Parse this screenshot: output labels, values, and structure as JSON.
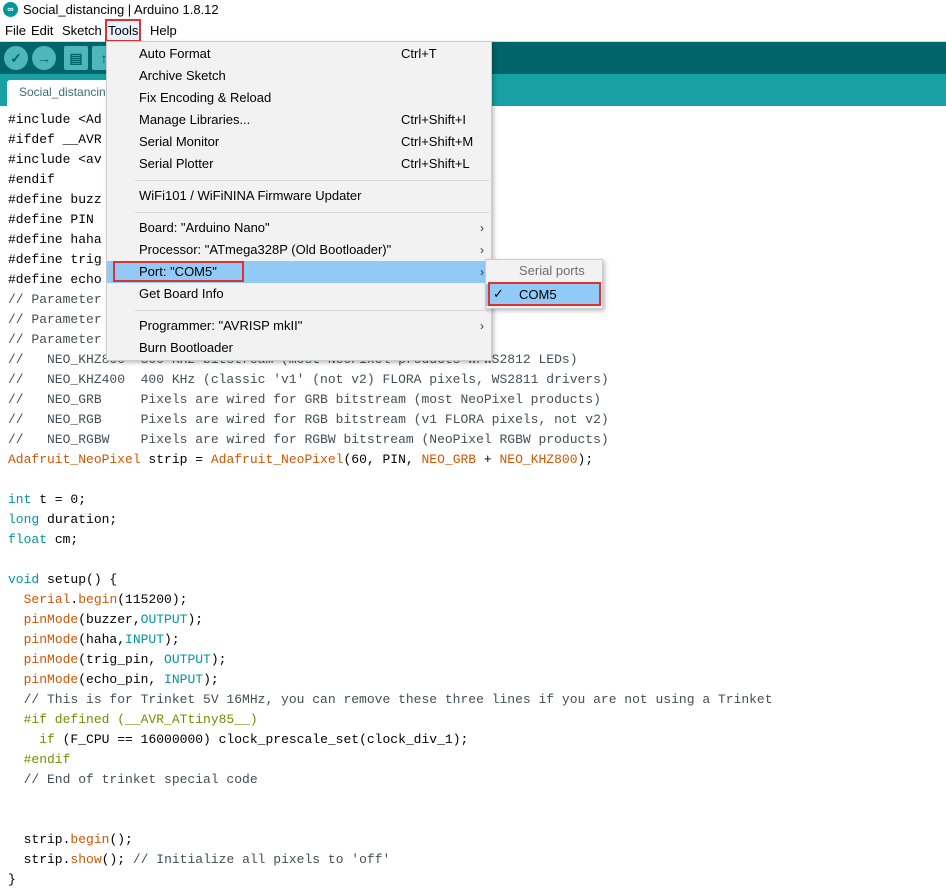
{
  "window": {
    "title": "Social_distancing | Arduino 1.8.12"
  },
  "menubar": [
    "File",
    "Edit",
    "Sketch",
    "Tools",
    "Help"
  ],
  "toolbar": {
    "buttons": [
      {
        "name": "verify-button",
        "icon": "checkmark-icon",
        "glyph": "✓"
      },
      {
        "name": "upload-button",
        "icon": "arrow-right-icon",
        "glyph": "→"
      },
      {
        "name": "new-button",
        "icon": "document-icon",
        "glyph": "▤"
      },
      {
        "name": "open-button",
        "icon": "open-arrow-icon",
        "glyph": "↑"
      }
    ]
  },
  "tab": {
    "label": "Social_distancing"
  },
  "tools_menu": {
    "items": [
      {
        "label": "Auto Format",
        "shortcut": "Ctrl+T"
      },
      {
        "label": "Archive Sketch",
        "shortcut": ""
      },
      {
        "label": "Fix Encoding & Reload",
        "shortcut": ""
      },
      {
        "label": "Manage Libraries...",
        "shortcut": "Ctrl+Shift+I"
      },
      {
        "label": "Serial Monitor",
        "shortcut": "Ctrl+Shift+M"
      },
      {
        "label": "Serial Plotter",
        "shortcut": "Ctrl+Shift+L"
      },
      {
        "label": "WiFi101 / WiFiNINA Firmware Updater",
        "shortcut": ""
      },
      {
        "label": "Board: \"Arduino Nano\"",
        "shortcut": "",
        "submenu": true
      },
      {
        "label": "Processor: \"ATmega328P (Old Bootloader)\"",
        "shortcut": "",
        "submenu": true
      },
      {
        "label": "Port: \"COM5\"",
        "shortcut": "",
        "submenu": true,
        "highlighted": true
      },
      {
        "label": "Get Board Info",
        "shortcut": ""
      },
      {
        "label": "Programmer: \"AVRISP mkII\"",
        "shortcut": "",
        "submenu": true
      },
      {
        "label": "Burn Bootloader",
        "shortcut": ""
      }
    ]
  },
  "port_submenu": {
    "header": "Serial ports",
    "items": [
      {
        "label": "COM5",
        "checked": true,
        "check_glyph": "✓"
      }
    ]
  },
  "code": [
    [
      [
        "#include <Ad",
        ""
      ]
    ],
    [
      [
        "#ifdef __AVR",
        ""
      ]
    ],
    [
      [
        "#include <av",
        ""
      ]
    ],
    [
      [
        "#endif",
        ""
      ]
    ],
    [
      [
        "#define buzz",
        ""
      ]
    ],
    [
      [
        "#define PIN",
        ""
      ]
    ],
    [
      [
        "#define haha",
        ""
      ]
    ],
    [
      [
        "#define trig",
        ""
      ]
    ],
    [
      [
        "#define echo",
        ""
      ]
    ],
    [
      [
        "// Parameter",
        "c-gray"
      ]
    ],
    [
      [
        "// Parameter",
        "c-gray"
      ]
    ],
    [
      [
        "// Parameter",
        "c-gray"
      ]
    ],
    [
      [
        "//   NEO_KHZ800  800 KHz bitstream (most NeoPixel products w/WS2812 LEDs)",
        "c-gray"
      ]
    ],
    [
      [
        "//   NEO_KHZ400  400 KHz (classic 'v1' (not v2) FLORA pixels, WS2811 drivers)",
        "c-gray"
      ]
    ],
    [
      [
        "//   NEO_GRB     Pixels are wired for GRB bitstream (most NeoPixel products)",
        "c-gray"
      ]
    ],
    [
      [
        "//   NEO_RGB     Pixels are wired for RGB bitstream (v1 FLORA pixels, not v2)",
        "c-gray"
      ]
    ],
    [
      [
        "//   NEO_RGBW    Pixels are wired for RGBW bitstream (NeoPixel RGBW products)",
        "c-gray"
      ]
    ],
    [
      [
        "Adafruit_NeoPixel",
        "c-orange"
      ],
      [
        " strip = ",
        ""
      ],
      [
        "Adafruit_NeoPixel",
        "c-orange"
      ],
      [
        "(60, PIN, ",
        ""
      ],
      [
        "NEO_GRB",
        "c-orange"
      ],
      [
        " + ",
        ""
      ],
      [
        "NEO_KHZ800",
        "c-orange"
      ],
      [
        ");",
        ""
      ]
    ],
    [
      [
        "",
        ""
      ]
    ],
    [
      [
        "int",
        "c-teal"
      ],
      [
        " t = 0;",
        ""
      ]
    ],
    [
      [
        "long",
        "c-teal"
      ],
      [
        " duration;",
        ""
      ]
    ],
    [
      [
        "float",
        "c-teal"
      ],
      [
        " cm;",
        ""
      ]
    ],
    [
      [
        "",
        ""
      ]
    ],
    [
      [
        "void",
        "c-teal"
      ],
      [
        " setup() {",
        ""
      ]
    ],
    [
      [
        "  ",
        ""
      ],
      [
        "Serial",
        "c-orange"
      ],
      [
        ".",
        ""
      ],
      [
        "begin",
        "c-orange"
      ],
      [
        "(115200);",
        ""
      ]
    ],
    [
      [
        "  ",
        ""
      ],
      [
        "pinMode",
        "c-orange"
      ],
      [
        "(buzzer,",
        ""
      ],
      [
        "OUTPUT",
        "c-teal"
      ],
      [
        ");",
        ""
      ]
    ],
    [
      [
        "  ",
        ""
      ],
      [
        "pinMode",
        "c-orange"
      ],
      [
        "(haha,",
        ""
      ],
      [
        "INPUT",
        "c-teal"
      ],
      [
        ");",
        ""
      ]
    ],
    [
      [
        "  ",
        ""
      ],
      [
        "pinMode",
        "c-orange"
      ],
      [
        "(trig_pin, ",
        ""
      ],
      [
        "OUTPUT",
        "c-teal"
      ],
      [
        ");",
        ""
      ]
    ],
    [
      [
        "  ",
        ""
      ],
      [
        "pinMode",
        "c-orange"
      ],
      [
        "(echo_pin, ",
        ""
      ],
      [
        "INPUT",
        "c-teal"
      ],
      [
        ");",
        ""
      ]
    ],
    [
      [
        "  // This is for Trinket 5V 16MHz, you can remove these three lines if you are not using a Trinket",
        "c-gray"
      ]
    ],
    [
      [
        "  #if defined (__AVR_ATtiny85__)",
        "c-kw"
      ]
    ],
    [
      [
        "    ",
        ""
      ],
      [
        "if",
        "c-kw"
      ],
      [
        " (F_CPU == 16000000) clock_prescale_set(clock_div_1);",
        ""
      ]
    ],
    [
      [
        "  #endif",
        "c-kw"
      ]
    ],
    [
      [
        "  // End of trinket special code",
        "c-gray"
      ]
    ],
    [
      [
        "",
        ""
      ]
    ],
    [
      [
        "",
        ""
      ]
    ],
    [
      [
        "  strip.",
        ""
      ],
      [
        "begin",
        "c-orange"
      ],
      [
        "();",
        ""
      ]
    ],
    [
      [
        "  strip.",
        ""
      ],
      [
        "show",
        "c-orange"
      ],
      [
        "(); ",
        ""
      ],
      [
        "// Initialize all pixels to 'off'",
        "c-gray"
      ]
    ],
    [
      [
        "}",
        ""
      ]
    ]
  ]
}
